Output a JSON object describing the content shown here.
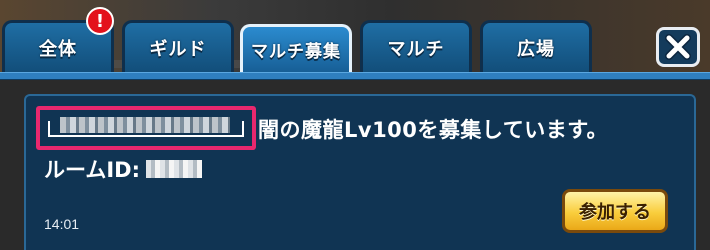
{
  "tabs": [
    {
      "label": "全体",
      "active": false
    },
    {
      "label": "ギルド",
      "active": false
    },
    {
      "label": "マルチ募集",
      "active": true
    },
    {
      "label": "マルチ",
      "active": false
    },
    {
      "label": "広場",
      "active": false
    }
  ],
  "badge": {
    "label": "!"
  },
  "close_icon": "close-x-icon",
  "message": {
    "text": "闇の魔龍Lv100を募集しています。",
    "room_label": "ルームID:",
    "time": "14:01",
    "join_label": "参加する"
  },
  "colors": {
    "tab": "#1f6ea4",
    "panel": "#103453",
    "highlight": "#e8286e",
    "join": "#f9cd3c",
    "badge": "#e3121c"
  }
}
